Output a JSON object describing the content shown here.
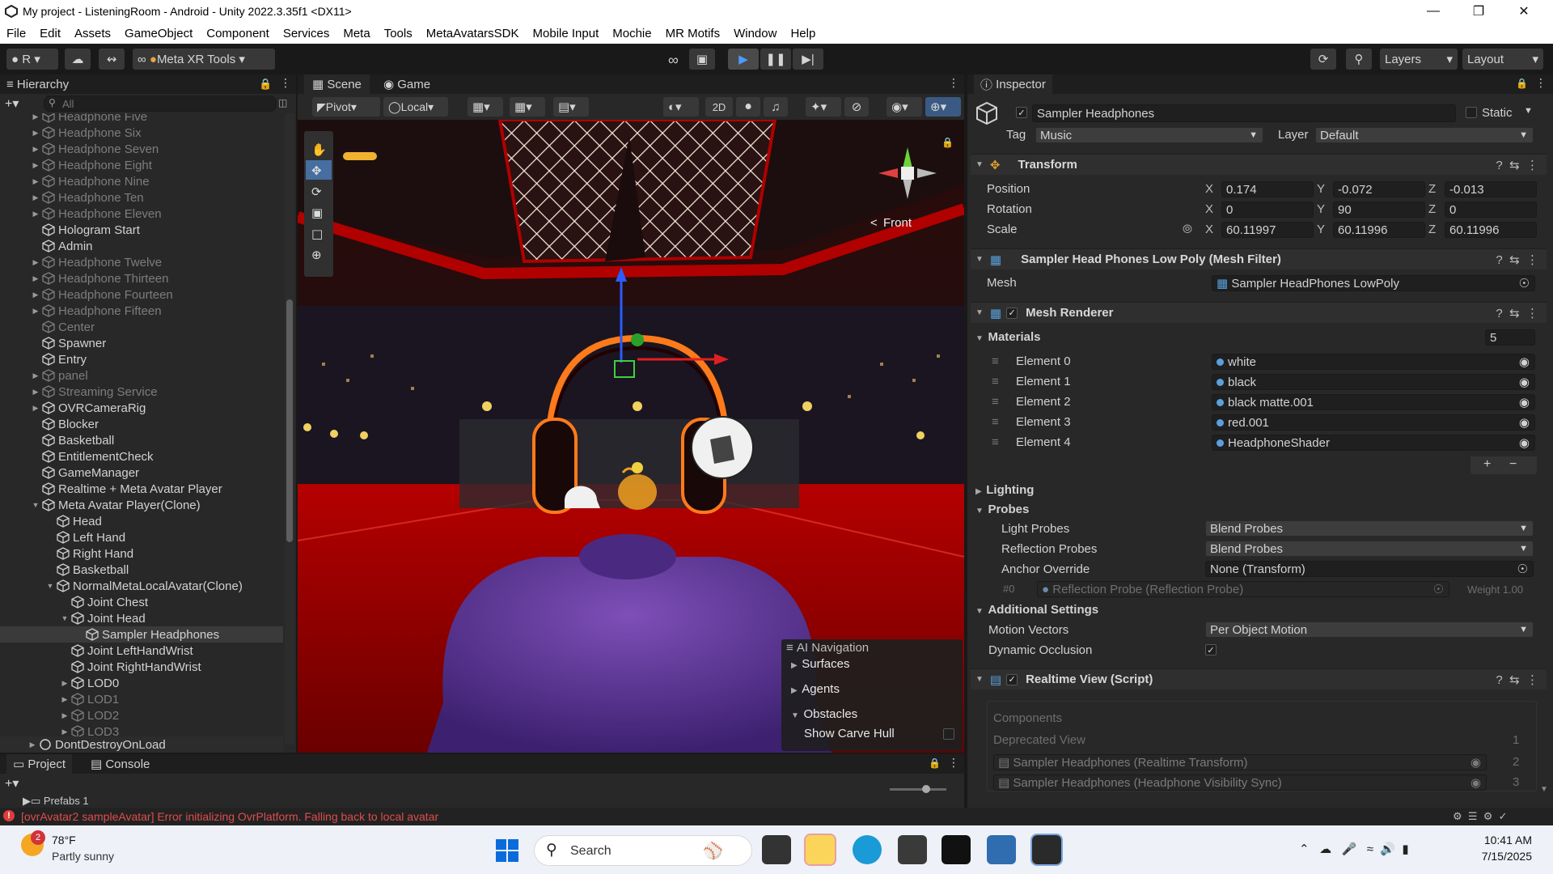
{
  "window": {
    "title": "My project - ListeningRoom - Android - Unity 2022.3.35f1 <DX11>"
  },
  "menu": [
    "File",
    "Edit",
    "Assets",
    "GameObject",
    "Component",
    "Services",
    "Meta",
    "Tools",
    "MetaAvatarsSDK",
    "Mobile Input",
    "Mochie",
    "MR Motifs",
    "Window",
    "Help"
  ],
  "toolbar": {
    "account": "R",
    "meta_tools": "Meta XR Tools",
    "layers": "Layers",
    "layout": "Layout"
  },
  "hierarchy": {
    "tab": "Hierarchy",
    "search_placeholder": "All",
    "items": [
      {
        "label": "Headphone Five",
        "dim": true
      },
      {
        "label": "Headphone Six",
        "dim": true
      },
      {
        "label": "Headphone Seven",
        "dim": true
      },
      {
        "label": "Headphone Eight",
        "dim": true
      },
      {
        "label": "Headphone Nine",
        "dim": true
      },
      {
        "label": "Headphone Ten",
        "dim": true
      },
      {
        "label": "Headphone Eleven",
        "dim": true
      },
      {
        "label": "Hologram Start",
        "dim": false
      },
      {
        "label": "Admin",
        "dim": false
      },
      {
        "label": "Headphone Twelve",
        "dim": true
      },
      {
        "label": "Headphone Thirteen",
        "dim": true
      },
      {
        "label": "Headphone Fourteen",
        "dim": true
      },
      {
        "label": "Headphone Fifteen",
        "dim": true
      },
      {
        "label": "Center",
        "dim": true
      },
      {
        "label": "Spawner",
        "dim": false
      },
      {
        "label": "Entry",
        "dim": false
      },
      {
        "label": "panel",
        "dim": true
      },
      {
        "label": "Streaming Service",
        "dim": true
      },
      {
        "label": "OVRCameraRig",
        "dim": false
      },
      {
        "label": "Blocker",
        "dim": false
      },
      {
        "label": "Basketball",
        "dim": false
      },
      {
        "label": "EntitlementCheck",
        "dim": false
      },
      {
        "label": "GameManager",
        "dim": false
      },
      {
        "label": "Realtime + Meta Avatar Player",
        "dim": false
      },
      {
        "label": "Meta Avatar Player(Clone)",
        "dim": false
      },
      {
        "label": "Head",
        "dim": false
      },
      {
        "label": "Left Hand",
        "dim": false
      },
      {
        "label": "Right Hand",
        "dim": false
      },
      {
        "label": "Basketball",
        "dim": false
      },
      {
        "label": "NormalMetaLocalAvatar(Clone)",
        "dim": false
      },
      {
        "label": "Joint Chest",
        "dim": false
      },
      {
        "label": "Joint Head",
        "dim": false
      },
      {
        "label": "Sampler Headphones",
        "dim": false
      },
      {
        "label": "Joint LeftHandWrist",
        "dim": false
      },
      {
        "label": "Joint RightHandWrist",
        "dim": false
      },
      {
        "label": "LOD0",
        "dim": false
      },
      {
        "label": "LOD1",
        "dim": true
      },
      {
        "label": "LOD2",
        "dim": true
      },
      {
        "label": "LOD3",
        "dim": true
      }
    ],
    "dont_destroy": "DontDestroyOnLoad"
  },
  "scene": {
    "tab_scene": "Scene",
    "tab_game": "Game",
    "pivot": "Pivot",
    "local": "Local",
    "mode_2d": "2D",
    "gizmo_label": "Front",
    "ai_nav": {
      "title": "AI Navigation",
      "items": [
        "Surfaces",
        "Agents",
        "Obstacles"
      ],
      "show_carve": "Show Carve Hull"
    }
  },
  "bottom": {
    "tab_project": "Project",
    "tab_console": "Console",
    "folder": "Prefabs 1"
  },
  "status": {
    "error": "[ovrAvatar2 sampleAvatar] Error initializing OvrPlatform. Falling back to local avatar"
  },
  "inspector": {
    "tab": "Inspector",
    "name": "Sampler Headphones",
    "static": "Static",
    "tag_label": "Tag",
    "tag": "Music",
    "layer_label": "Layer",
    "layer": "Default",
    "transform": {
      "title": "Transform",
      "position": {
        "label": "Position",
        "x": "0.174",
        "y": "-0.072",
        "z": "-0.013"
      },
      "rotation": {
        "label": "Rotation",
        "x": "0",
        "y": "90",
        "z": "0"
      },
      "scale": {
        "label": "Scale",
        "x": "60.11997",
        "y": "60.11996",
        "z": "60.11996"
      }
    },
    "mesh_filter": {
      "title": "Sampler Head Phones Low Poly (Mesh Filter)",
      "mesh_label": "Mesh",
      "mesh": "Sampler HeadPhones LowPoly"
    },
    "mesh_renderer": {
      "title": "Mesh Renderer",
      "materials_label": "Materials",
      "count": "5",
      "elements": [
        {
          "label": "Element 0",
          "value": "white"
        },
        {
          "label": "Element 1",
          "value": "black"
        },
        {
          "label": "Element 2",
          "value": "black matte.001"
        },
        {
          "label": "Element 3",
          "value": "red.001"
        },
        {
          "label": "Element 4",
          "value": "HeadphoneShader"
        }
      ],
      "lighting": "Lighting",
      "probes": "Probes",
      "light_probes_label": "Light Probes",
      "light_probes": "Blend Probes",
      "reflection_probes_label": "Reflection Probes",
      "reflection_probes": "Blend Probes",
      "anchor_label": "Anchor Override",
      "anchor": "None (Transform)",
      "probe_index": "#0",
      "probe_ref": "Reflection Probe (Reflection Probe)",
      "probe_weight": "Weight 1.00",
      "additional": "Additional Settings",
      "motion_label": "Motion Vectors",
      "motion": "Per Object Motion",
      "dyn_occlusion": "Dynamic Occlusion"
    },
    "realtime_view": {
      "title": "Realtime View (Script)",
      "components": "Components",
      "deprecated": "Deprecated View",
      "deprecated_n": "1",
      "rows": [
        {
          "label": "Sampler Headphones (Realtime Transform)",
          "n": "2"
        },
        {
          "label": "Sampler Headphones (Headphone Visibility Sync)",
          "n": "3"
        }
      ]
    }
  },
  "taskbar": {
    "temp": "78°F",
    "weather": "Partly sunny",
    "badge": "2",
    "search": "Search",
    "time": "10:41 AM",
    "date": "7/15/2025"
  }
}
